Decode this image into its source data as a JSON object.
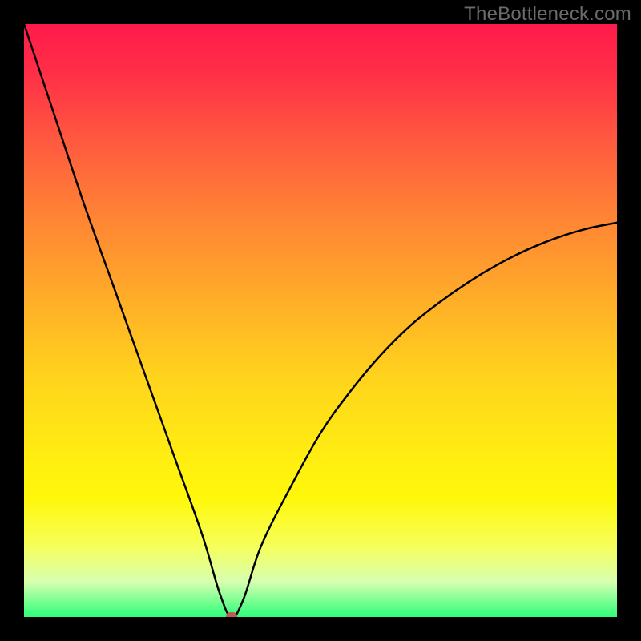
{
  "watermark": {
    "text": "TheBottleneck.com"
  },
  "colors": {
    "curve": "#000000",
    "marker": "#c15a53",
    "gradient_top": "#ff1a4b",
    "gradient_mid": "#ffe814",
    "gradient_bottom": "#2eff7a"
  },
  "chart_data": {
    "type": "line",
    "title": "",
    "xlabel": "",
    "ylabel": "",
    "xlim": [
      0,
      100
    ],
    "ylim": [
      0,
      100
    ],
    "grid": false,
    "legend": false,
    "x": [
      0,
      5,
      10,
      15,
      20,
      25,
      30,
      33,
      35,
      37,
      40,
      45,
      50,
      55,
      60,
      65,
      70,
      75,
      80,
      85,
      90,
      95,
      100
    ],
    "y": [
      100,
      85,
      70,
      56,
      42,
      28,
      14,
      4,
      0,
      3,
      12,
      22,
      31,
      38,
      44,
      49,
      53,
      56.5,
      59.5,
      62,
      64,
      65.5,
      66.5
    ],
    "marker_point": {
      "x": 35,
      "y": 0
    },
    "note": "V-shaped bottleneck curve; minimum at x≈35 with y≈0. Values estimated from gradient position."
  }
}
